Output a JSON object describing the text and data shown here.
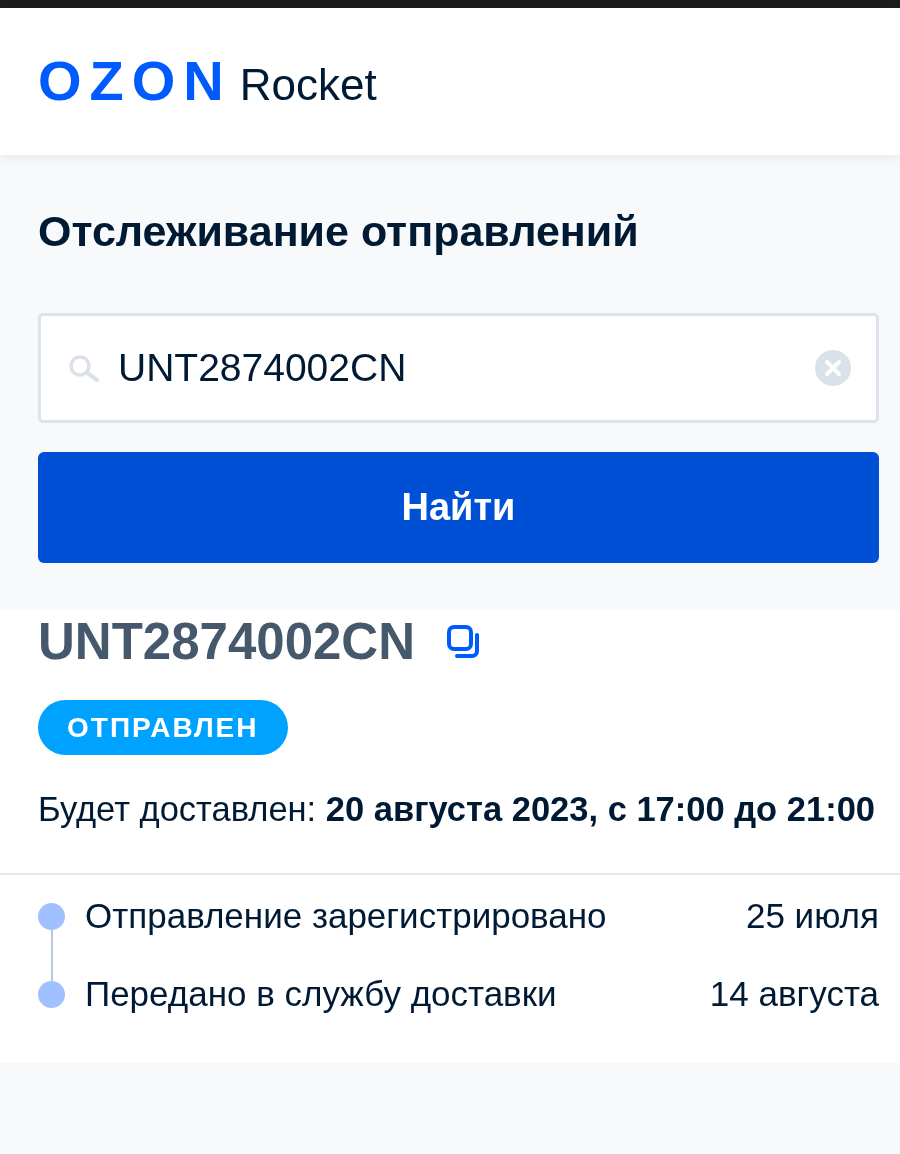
{
  "header": {
    "logo": {
      "brand": "OZON",
      "product": "Rocket"
    }
  },
  "tracking_form": {
    "title": "Отслеживание отправлений",
    "search": {
      "value": "UNT2874002CN"
    },
    "submit_button": "Найти"
  },
  "shipment": {
    "number": "UNT2874002CN",
    "status": "ОТПРАВЛЕН",
    "delivery": "Будет доставлен: **20 августа 2023, с 17:00 до 21:00**"
  },
  "events": [
    {
      "label": "Отправление зарегистрировано",
      "date": "25 июля"
    },
    {
      "label": "Передано в службу доставки",
      "date": "14 августа"
    }
  ]
}
